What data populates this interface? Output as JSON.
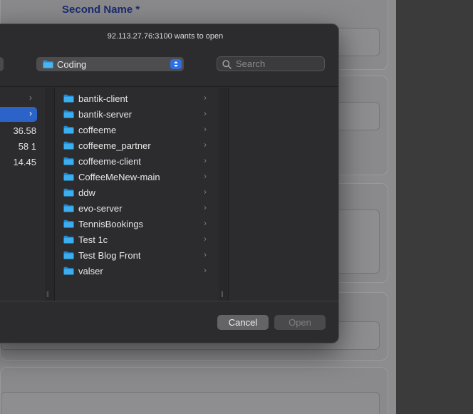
{
  "background": {
    "field_label": "Second Name *"
  },
  "dialog": {
    "title": "92.113.27.76:3100 wants to open",
    "location": "Coding",
    "search_placeholder": "Search",
    "left_column": {
      "rows": [
        "",
        "",
        "36.58",
        "58 1",
        "14.45"
      ]
    },
    "folders": [
      "bantik-client",
      "bantik-server",
      "coffeeme",
      "coffeeme_partner",
      "coffeeme-client",
      "CoffeeMeNew-main",
      "ddw",
      "evo-server",
      "TennisBookings",
      "Test 1c",
      "Test Blog Front",
      "valser"
    ],
    "buttons": {
      "cancel": "Cancel",
      "open": "Open"
    }
  },
  "colors": {
    "accent": "#2b63c9",
    "folder": "#35a7ec",
    "dialog_bg": "#2c2c2e"
  }
}
